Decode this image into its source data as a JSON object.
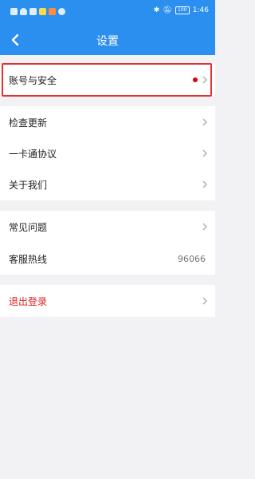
{
  "status_bar": {
    "time": "1:46",
    "battery_level": "100",
    "icons": [
      "notification-icon",
      "wifi-icon",
      "signal-icon",
      "app-icon",
      "app-icon",
      "app-icon"
    ],
    "right_icons": [
      "bluetooth-icon",
      "mute-icon"
    ]
  },
  "header": {
    "title": "设置",
    "back_icon": "chevron-left-icon"
  },
  "groups": [
    {
      "items": [
        {
          "label": "账号与安全",
          "badge": "red-dot"
        }
      ]
    },
    {
      "items": [
        {
          "label": "检查更新"
        },
        {
          "label": "一卡通协议"
        },
        {
          "label": "关于我们"
        }
      ]
    },
    {
      "items": [
        {
          "label": "常见问题"
        },
        {
          "label": "客服热线",
          "value": "96066"
        }
      ]
    },
    {
      "items": [
        {
          "label": "退出登录",
          "style": "danger"
        }
      ]
    }
  ],
  "colors": {
    "header_bg": "#2b8ff0",
    "page_bg": "#f2f2f4",
    "danger": "#e02020",
    "highlight_border": "#e53030"
  }
}
